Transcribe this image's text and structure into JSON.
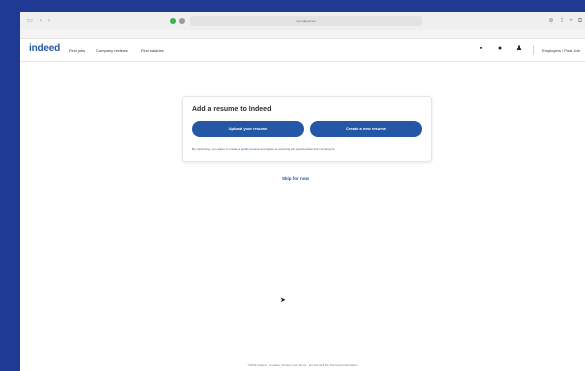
{
  "browser": {
    "url": "my.indeed.com",
    "icons": [
      "sidebar-icon",
      "back-icon",
      "forward-icon",
      "share-icon",
      "new-tab-icon"
    ]
  },
  "header": {
    "logo": "indeed",
    "nav": [
      "Find jobs",
      "Company reviews",
      "Find salaries"
    ],
    "employers": "Employers / Post Job"
  },
  "card": {
    "title": "Add a resume to Indeed",
    "upload_label": "Upload your resume",
    "create_label": "Create a new resume",
    "consent_prefix": "By continuing, you agree to create a ",
    "consent_link": "public resume",
    "consent_suffix": " and agree to receiving job opportunities from employers."
  },
  "skip_label": "Skip for now",
  "footer": "©2024 Indeed · Cookies, Privacy and Terms · Do Not Sell My Personal Information",
  "colors": {
    "brand": "#2557a7",
    "background": "#1f3a93"
  }
}
